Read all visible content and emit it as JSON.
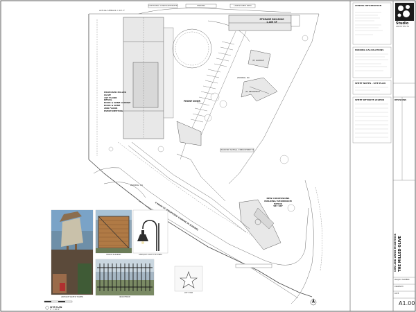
{
  "title_block": {
    "owner_line1": "CHRI AND ANNIE MCGETRICK",
    "project_name": "THE MILLED OLIVE",
    "sheet_number": "A1.00",
    "logo_text": "Studio",
    "logo_sub": "ARCHITECTS",
    "rows": [
      {
        "label": "PROJECT NUMBER",
        "value": ""
      },
      {
        "label": "DRAWN BY",
        "value": ""
      },
      {
        "label": "DATE",
        "value": ""
      },
      {
        "label": "SUBMITTAL",
        "value": ""
      }
    ]
  },
  "info_panels": {
    "zoning_title": "ZONING INFORMATION",
    "parking_title": "PARKING CALCULATIONS",
    "notes_title": "SHEET NOTES - SITE PLAN",
    "legend_title": "SHEET KEYNOTE LEGEND",
    "revisions_title": "REVISIONS"
  },
  "plan_labels": {
    "storage": "STORAGE BUILDING\n1,405 SF",
    "proposed": "PROPOSED MILLED OLIVE\n1ST FLOOR\nRETAIL\nBOOK & WINE LOUNGE\nBOOK & WINE\n2ND FLOOR\nEVENT/MEETING",
    "front_door": "FRONT DOOR",
    "showroom": "NEW CONCESSIONS\nBUILDING/ SHOWROOM\nPATIOS\n587 SSF",
    "street": "S MAIN ST (PROPOSED CHANGE IN ZONING)",
    "zoning_r1": "ZONING: R1",
    "zoning_rc": "ZONING: RC",
    "garage": "(E) GARAGE",
    "residence": "(E) RESIDENCE",
    "setback": "ACTUAL SETBACK = 18'-7\"",
    "additional_trees": "ADDITIONAL LANDSCAPE BUFFER",
    "easement": "PROPOSED SIDEWALK IMPROVEMENT PROPERTY",
    "landscape_area": "LANDSCAPED AREA",
    "parking": "PARKING"
  },
  "photo_captions": {
    "tower": "ANTIQUE WATER TOWER",
    "fence": "FENCE ELEMENT",
    "lamp": "ANTIQUE LIGHT FIXTURES",
    "iron_fence": "IRON FENCE",
    "star": "LOT STAR"
  },
  "footer": {
    "scale_label": "SITE PLAN",
    "scale_value": "1\" = 20'-0\""
  },
  "colors": {
    "line": "#555555",
    "fill_building": "#e8e8e8",
    "wood": "#b07a45",
    "sky": "#7aa3c7"
  }
}
